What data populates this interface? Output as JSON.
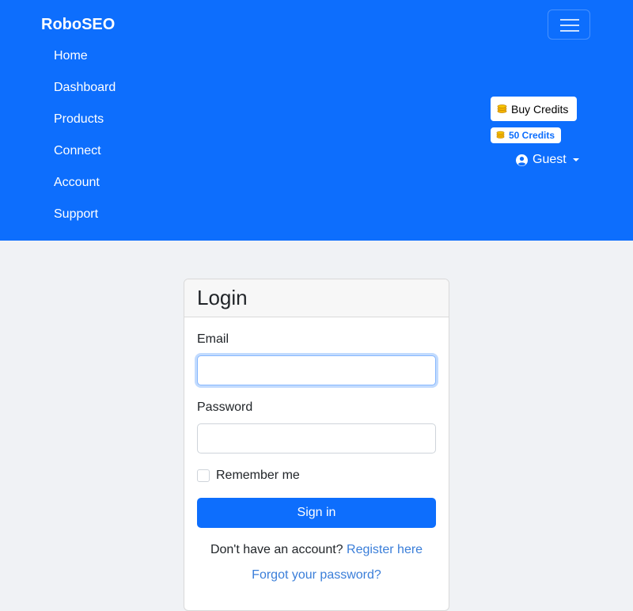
{
  "navbar": {
    "brand": "RoboSEO",
    "toggler_icon": "hamburger-icon",
    "items": [
      {
        "label": "Home"
      },
      {
        "label": "Dashboard"
      },
      {
        "label": "Products"
      },
      {
        "label": "Connect"
      },
      {
        "label": "Account"
      },
      {
        "label": "Support"
      }
    ],
    "buy_credits_label": "Buy Credits",
    "credits_badge": "50 Credits",
    "coin_icon": "coins-icon",
    "user_icon": "user-circle-icon",
    "user_label": "Guest",
    "colors": {
      "background": "#0d6efd",
      "coin": "#f4b400"
    }
  },
  "login": {
    "title": "Login",
    "email_label": "Email",
    "email_value": "",
    "password_label": "Password",
    "password_value": "",
    "remember_label": "Remember me",
    "remember_checked": false,
    "signin_label": "Sign in",
    "no_account_text": "Don't have an account?",
    "register_link": "Register here",
    "forgot_link": "Forgot your password?",
    "colors": {
      "primary": "#0d6efd",
      "link": "#3a7ed9"
    }
  }
}
